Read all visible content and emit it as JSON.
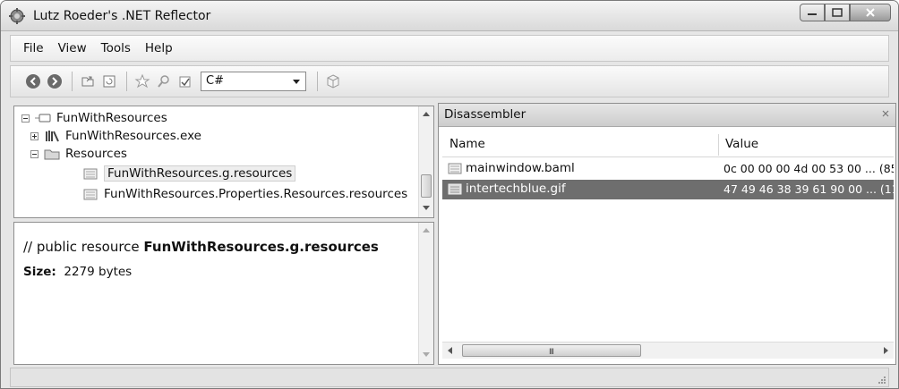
{
  "window": {
    "title": "Lutz Roeder's .NET Reflector"
  },
  "menu": {
    "items": [
      "File",
      "View",
      "Tools",
      "Help"
    ]
  },
  "toolbar": {
    "buttons": [
      "back-icon",
      "forward-icon",
      "open-icon",
      "refresh-icon",
      "bookmark-icon",
      "search-icon",
      "check-icon",
      "cube-icon"
    ],
    "language": "C#"
  },
  "tree": {
    "nodes": [
      {
        "label": "FunWithResources",
        "expanded": true,
        "icon": "assembly-icon"
      },
      {
        "label": "FunWithResources.exe",
        "expanded": false,
        "icon": "library-icon"
      },
      {
        "label": "Resources",
        "expanded": true,
        "icon": "folder-icon"
      },
      {
        "label": "FunWithResources.g.resources",
        "selected": true,
        "icon": "resource-file-icon"
      },
      {
        "label": "FunWithResources.Properties.Resources.resources",
        "icon": "resource-file-icon"
      }
    ]
  },
  "detail": {
    "prefix": "// public resource ",
    "resource_name": "FunWithResources.g.resources",
    "size_label": "Size:",
    "size_value": "2279 bytes"
  },
  "disassembler": {
    "title": "Disassembler",
    "columns": [
      "Name",
      "Value"
    ],
    "rows": [
      {
        "name": "mainwindow.baml",
        "value": "0c 00 00 00 4d 00 53 00 ... (85",
        "selected": false
      },
      {
        "name": "intertechblue.gif",
        "value": "47 49 46 38 39 61 90 00 ... (11",
        "selected": true
      }
    ]
  },
  "colors": {
    "selection": "#6e6e6e",
    "chrome": "#e6e6e6"
  }
}
